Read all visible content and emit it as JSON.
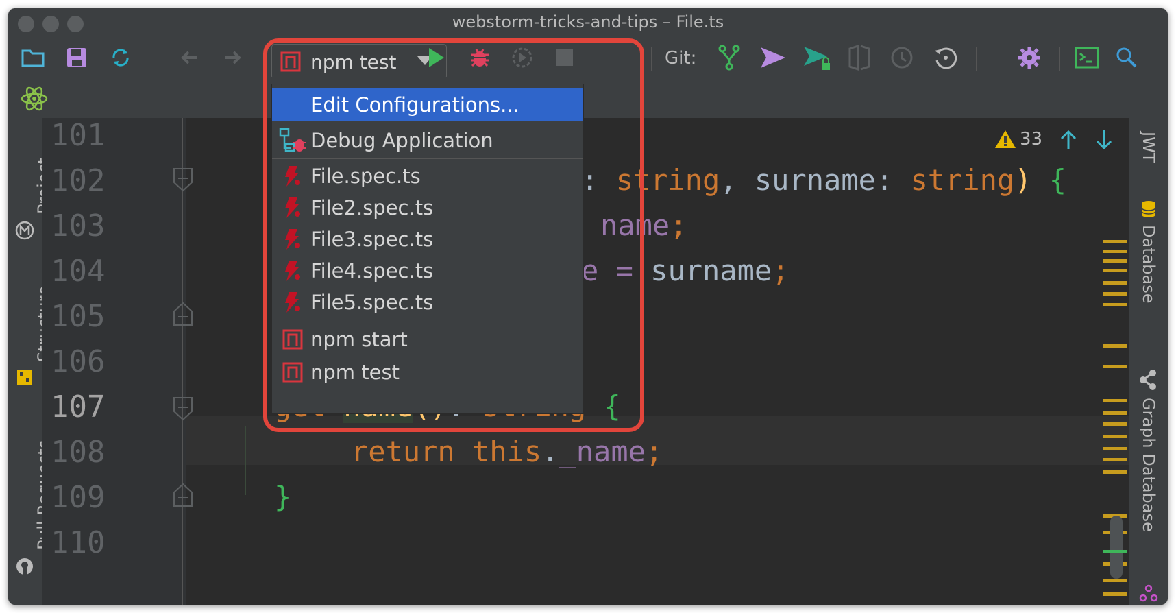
{
  "window": {
    "title": "webstorm-tricks-and-tips – File.ts"
  },
  "toolbar": {
    "run_config": "npm test",
    "git_label": "Git:",
    "icons": [
      "folder-icon",
      "save-icon",
      "sync-icon",
      "back-icon",
      "forward-icon",
      "npm-icon",
      "dropdown-icon",
      "run-icon",
      "debug-icon",
      "profile-icon",
      "stop-icon",
      "git-branch-icon",
      "git-push-icon",
      "git-commit-icon",
      "diff-icon",
      "history-icon",
      "rollback-icon",
      "settings-icon",
      "terminal-icon",
      "search-icon",
      "react-icon"
    ],
    "colors": {
      "run": "#3fb65a",
      "debug": "#e0415e",
      "git_push": "#b78be0",
      "git_commit": "#28a18b",
      "settings": "#b78be0",
      "terminal": "#3fb65a",
      "search": "#3e9bd6"
    }
  },
  "run_menu": {
    "items": [
      {
        "label": "Edit Configurations...",
        "icon": "",
        "selected": true
      },
      {
        "label": "Debug Application",
        "icon": "debug-app-icon"
      },
      {
        "label": "File.spec.ts",
        "icon": "jest-icon"
      },
      {
        "label": "File2.spec.ts",
        "icon": "jest-icon"
      },
      {
        "label": "File3.spec.ts",
        "icon": "jest-icon"
      },
      {
        "label": "File4.spec.ts",
        "icon": "jest-icon"
      },
      {
        "label": "File5.spec.ts",
        "icon": "jest-icon"
      },
      {
        "label": "npm start",
        "icon": "npm-icon"
      },
      {
        "label": "npm test",
        "icon": "npm-icon"
      }
    ],
    "highlight_color": "#e2453b"
  },
  "left_tabs": [
    "Project",
    "Structure",
    "Pull Requests"
  ],
  "right_tabs": [
    "JWT",
    "Database",
    "Graph Database"
  ],
  "editor": {
    "line_numbers": [
      "101",
      "102",
      "103",
      "104",
      "105",
      "106",
      "107",
      "108",
      "109",
      "110"
    ],
    "current_line": "107",
    "warning_count": "33",
    "code": {
      "l102": [
        ": ",
        "string",
        ", ",
        "surname",
        ": ",
        "string",
        ")",
        " {"
      ],
      "l103": [
        "name",
        ";"
      ],
      "l104": [
        "e = ",
        "surname",
        ";"
      ],
      "l107": [
        "get ",
        "name",
        "()",
        ": ",
        "string",
        " {"
      ],
      "l108": [
        "return ",
        "this",
        ".",
        "_name",
        ";"
      ],
      "l109": [
        "}"
      ]
    }
  }
}
